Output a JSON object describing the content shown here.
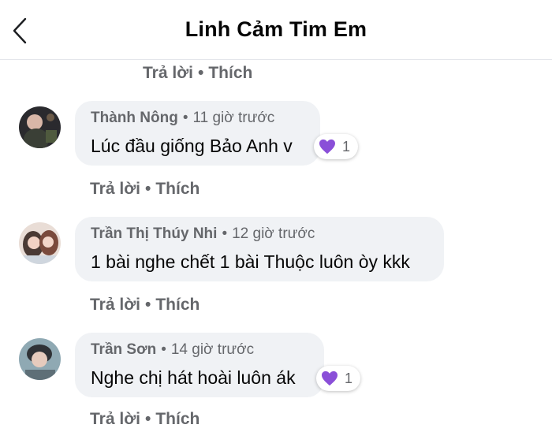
{
  "header": {
    "title": "Linh Cảm Tim Em"
  },
  "top_actions": {
    "reply": "Trả lời",
    "like": "Thích"
  },
  "comments": [
    {
      "name": "Thành Nông",
      "time": "11 giờ trước",
      "text": "Lúc đầu giống Bảo Anh v",
      "reaction": {
        "icon": "purple-heart-icon",
        "count": "1",
        "color": "#8a4fd8"
      },
      "actions": {
        "reply": "Trả lời",
        "like": "Thích"
      }
    },
    {
      "name": "Trần Thị Thúy Nhi",
      "time": "12 giờ trước",
      "text": "1 bài nghe chết 1 bài Thuộc luôn òy kkk",
      "actions": {
        "reply": "Trả lời",
        "like": "Thích"
      }
    },
    {
      "name": "Trần Sơn",
      "time": "14 giờ trước",
      "text": "Nghe chị hát hoài luôn ák",
      "reaction": {
        "icon": "purple-heart-icon",
        "count": "1",
        "color": "#8a4fd8"
      },
      "actions": {
        "reply": "Trả lời",
        "like": "Thích"
      }
    }
  ],
  "separator": "•"
}
